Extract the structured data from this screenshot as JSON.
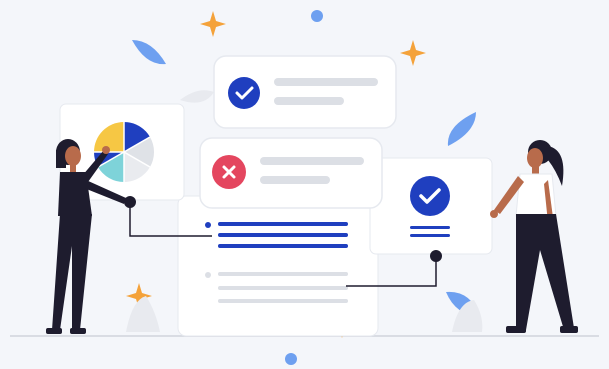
{
  "illustration": {
    "kind": "spot-illustration",
    "colors": {
      "background": "#f4f6fa",
      "card": "#ffffff",
      "card_border": "#e6e9ef",
      "primary_blue": "#1f3fbf",
      "light_blue": "#6ea0f0",
      "error_red": "#e4465f",
      "placeholder_line": "#dcdfe5",
      "dark_navy": "#1e1c2e",
      "sparkle_orange": "#f4a23a",
      "pie_yellow": "#f6c744",
      "pie_teal": "#7ed3d9",
      "pie_gray": "#dfe2e7",
      "skin": "#b86b4b",
      "shirt_white": "#ffffff"
    },
    "cards": [
      {
        "name": "approved-card",
        "status": "check-icon"
      },
      {
        "name": "rejected-card",
        "status": "x-icon"
      },
      {
        "name": "pie-chart-card",
        "status": "pie-chart-icon"
      },
      {
        "name": "badge-card",
        "status": "check-icon"
      },
      {
        "name": "document-card",
        "status": "list-icon"
      }
    ],
    "people": [
      {
        "name": "person-left"
      },
      {
        "name": "person-right"
      }
    ]
  }
}
